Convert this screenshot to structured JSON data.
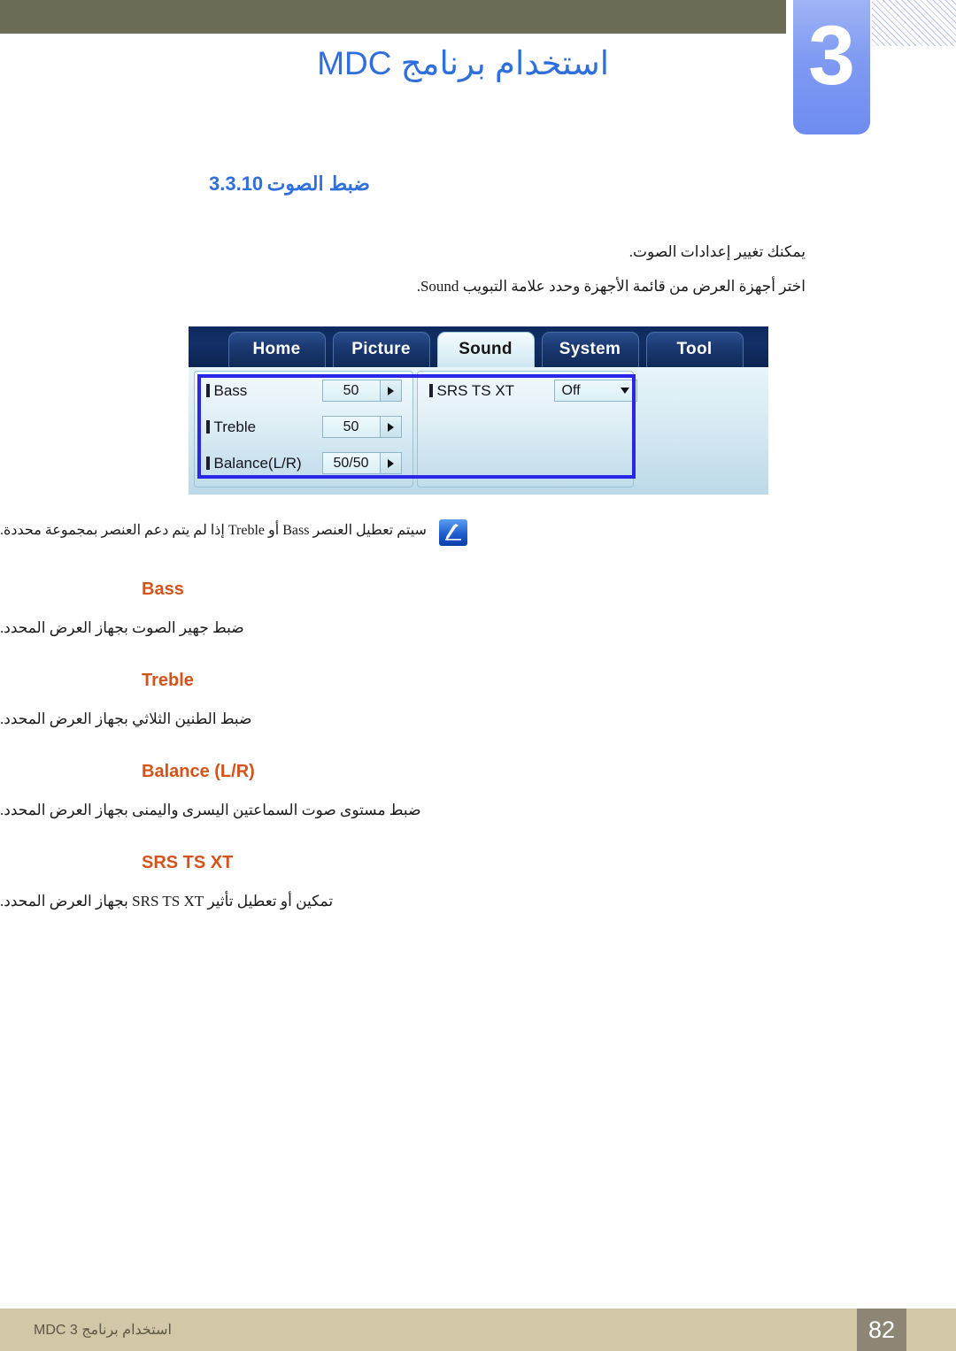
{
  "header": {
    "chapter_number": "3",
    "chapter_title": "استخدام برنامج MDC"
  },
  "section": {
    "number": "3.3.10",
    "title": "ضبط الصوت",
    "intro_line1": "يمكنك تغيير إعدادات الصوت.",
    "intro_line2": "اختر أجهزة العرض من قائمة الأجهزة وحدد علامة التبويب Sound."
  },
  "mdc_screenshot": {
    "tabs": [
      {
        "label": "Home",
        "active": false
      },
      {
        "label": "Picture",
        "active": false
      },
      {
        "label": "Sound",
        "active": true
      },
      {
        "label": "System",
        "active": false
      },
      {
        "label": "Tool",
        "active": false
      }
    ],
    "left_panel": [
      {
        "label": "Bass",
        "value": "50",
        "control": "spinner-right-arrow"
      },
      {
        "label": "Treble",
        "value": "50",
        "control": "spinner-right-arrow"
      },
      {
        "label": "Balance(L/R)",
        "value": "50/50",
        "control": "spinner-right-arrow"
      }
    ],
    "right_panel": [
      {
        "label": "SRS TS XT",
        "value": "Off",
        "control": "dropdown"
      }
    ]
  },
  "note": {
    "icon": "note-pencil-icon",
    "text": "سيتم تعطيل العنصر Bass أو Treble إذا لم يتم دعم العنصر بمجموعة محددة."
  },
  "terms": [
    {
      "title": "Bass",
      "description": "ضبط جهير الصوت بجهاز العرض المحدد."
    },
    {
      "title": "Treble",
      "description": "ضبط الطنين الثلاثي بجهاز العرض المحدد."
    },
    {
      "title": "Balance (L/R)",
      "description": "ضبط مستوى صوت السماعتين اليسرى واليمنى بجهاز العرض المحدد."
    },
    {
      "title": "SRS TS XT",
      "description": "تمكين أو تعطيل تأثير SRS TS XT بجهاز العرض المحدد."
    }
  ],
  "footer": {
    "text": "استخدام برنامج MDC 3",
    "page_number": "82"
  },
  "colors": {
    "accent_blue": "#2f6fdc",
    "term_orange": "#d4531a",
    "olive_bar": "#6b6b56",
    "footer_bar": "#d2c7a6",
    "page_box": "#8d8575",
    "chapter_tab": "#7f9af2",
    "mdc_highlight": "#2b27ea"
  }
}
